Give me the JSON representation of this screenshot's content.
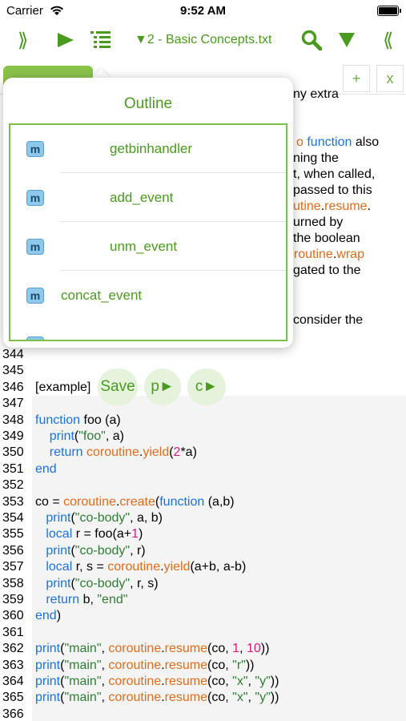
{
  "status_bar": {
    "carrier": "Carrier",
    "time": "9:52 AM"
  },
  "toolbar": {
    "expand": "⟫",
    "collapse": "⟪",
    "file_title": "▼2 - Basic Concepts.txt"
  },
  "tabs": {
    "add": "+",
    "close": "x"
  },
  "prose": [
    {
      "parts": [
        {
          "t": "ny extra",
          "c": ""
        }
      ]
    },
    {
      "parts": [
        {
          "t": "o ",
          "c": "orange"
        },
        {
          "t": "function",
          "c": "blue"
        },
        {
          "t": " also",
          "c": ""
        }
      ]
    },
    {
      "parts": [
        {
          "t": "ning the",
          "c": ""
        }
      ]
    },
    {
      "parts": [
        {
          "t": "t, when called,",
          "c": ""
        }
      ]
    },
    {
      "parts": [
        {
          "t": "passed to this",
          "c": ""
        }
      ]
    },
    {
      "parts": [
        {
          "t": "utine",
          "c": "orange"
        },
        {
          "t": ".",
          "c": ""
        },
        {
          "t": "resume",
          "c": "orange"
        },
        {
          "t": ".",
          "c": ""
        }
      ]
    },
    {
      "parts": [
        {
          "t": "urned by",
          "c": ""
        }
      ]
    },
    {
      "parts": [
        {
          "t": "the boolean",
          "c": ""
        }
      ]
    },
    {
      "parts": [
        {
          "t": "oroutine",
          "c": "orange"
        },
        {
          "t": ".",
          "c": ""
        },
        {
          "t": "wrap",
          "c": "orange"
        }
      ]
    },
    {
      "parts": [
        {
          "t": "gated to the",
          "c": ""
        }
      ]
    },
    {
      "parts": [
        {
          "t": "consider the",
          "c": ""
        }
      ]
    }
  ],
  "example": {
    "label": "[example]",
    "save": "Save",
    "p": "p►",
    "c": "c►"
  },
  "code_lines": [
    {
      "n": "344",
      "parts": []
    },
    {
      "n": "345",
      "parts": []
    },
    {
      "n": "346",
      "parts": []
    },
    {
      "n": "347",
      "parts": []
    },
    {
      "n": "348",
      "parts": [
        {
          "t": "function",
          "c": "kw"
        },
        {
          "t": " foo (a)",
          "c": ""
        }
      ]
    },
    {
      "n": "349",
      "parts": [
        {
          "t": "    ",
          "c": ""
        },
        {
          "t": "print",
          "c": "kw"
        },
        {
          "t": "(",
          "c": ""
        },
        {
          "t": "\"foo\"",
          "c": "str"
        },
        {
          "t": ", a)",
          "c": ""
        }
      ]
    },
    {
      "n": "350",
      "parts": [
        {
          "t": "    ",
          "c": ""
        },
        {
          "t": "return",
          "c": "kw"
        },
        {
          "t": " ",
          "c": ""
        },
        {
          "t": "coroutine",
          "c": "fn"
        },
        {
          "t": ".",
          "c": ""
        },
        {
          "t": "yield",
          "c": "fn"
        },
        {
          "t": "(",
          "c": ""
        },
        {
          "t": "2",
          "c": "num"
        },
        {
          "t": "*a)",
          "c": ""
        }
      ]
    },
    {
      "n": "351",
      "parts": [
        {
          "t": "end",
          "c": "kw"
        }
      ]
    },
    {
      "n": "352",
      "parts": []
    },
    {
      "n": "353",
      "parts": [
        {
          "t": "co = ",
          "c": ""
        },
        {
          "t": "coroutine",
          "c": "fn"
        },
        {
          "t": ".",
          "c": ""
        },
        {
          "t": "create",
          "c": "fn"
        },
        {
          "t": "(",
          "c": ""
        },
        {
          "t": "function",
          "c": "kw"
        },
        {
          "t": " (a,b)",
          "c": ""
        }
      ]
    },
    {
      "n": "354",
      "parts": [
        {
          "t": "   ",
          "c": ""
        },
        {
          "t": "print",
          "c": "kw"
        },
        {
          "t": "(",
          "c": ""
        },
        {
          "t": "\"co-body\"",
          "c": "str"
        },
        {
          "t": ", a, b)",
          "c": ""
        }
      ]
    },
    {
      "n": "355",
      "parts": [
        {
          "t": "   ",
          "c": ""
        },
        {
          "t": "local",
          "c": "kw"
        },
        {
          "t": " r = foo(a+",
          "c": ""
        },
        {
          "t": "1",
          "c": "num"
        },
        {
          "t": ")",
          "c": ""
        }
      ]
    },
    {
      "n": "356",
      "parts": [
        {
          "t": "   ",
          "c": ""
        },
        {
          "t": "print",
          "c": "kw"
        },
        {
          "t": "(",
          "c": ""
        },
        {
          "t": "\"co-body\"",
          "c": "str"
        },
        {
          "t": ", r)",
          "c": ""
        }
      ]
    },
    {
      "n": "357",
      "parts": [
        {
          "t": "   ",
          "c": ""
        },
        {
          "t": "local",
          "c": "kw"
        },
        {
          "t": " r, s = ",
          "c": ""
        },
        {
          "t": "coroutine",
          "c": "fn"
        },
        {
          "t": ".",
          "c": ""
        },
        {
          "t": "yield",
          "c": "fn"
        },
        {
          "t": "(a+b, a-b)",
          "c": ""
        }
      ]
    },
    {
      "n": "358",
      "parts": [
        {
          "t": "   ",
          "c": ""
        },
        {
          "t": "print",
          "c": "kw"
        },
        {
          "t": "(",
          "c": ""
        },
        {
          "t": "\"co-body\"",
          "c": "str"
        },
        {
          "t": ", r, s)",
          "c": ""
        }
      ]
    },
    {
      "n": "359",
      "parts": [
        {
          "t": "   ",
          "c": ""
        },
        {
          "t": "return",
          "c": "kw"
        },
        {
          "t": " b, ",
          "c": ""
        },
        {
          "t": "\"end\"",
          "c": "str"
        }
      ]
    },
    {
      "n": "360",
      "parts": [
        {
          "t": "end",
          "c": "kw"
        },
        {
          "t": ")",
          "c": ""
        }
      ]
    },
    {
      "n": "361",
      "parts": []
    },
    {
      "n": "362",
      "parts": [
        {
          "t": "print",
          "c": "kw"
        },
        {
          "t": "(",
          "c": ""
        },
        {
          "t": "\"main\"",
          "c": "str"
        },
        {
          "t": ", ",
          "c": ""
        },
        {
          "t": "coroutine",
          "c": "fn"
        },
        {
          "t": ".",
          "c": ""
        },
        {
          "t": "resume",
          "c": "fn"
        },
        {
          "t": "(co, ",
          "c": ""
        },
        {
          "t": "1",
          "c": "num"
        },
        {
          "t": ", ",
          "c": ""
        },
        {
          "t": "10",
          "c": "num"
        },
        {
          "t": "))",
          "c": ""
        }
      ]
    },
    {
      "n": "363",
      "parts": [
        {
          "t": "print",
          "c": "kw"
        },
        {
          "t": "(",
          "c": ""
        },
        {
          "t": "\"main\"",
          "c": "str"
        },
        {
          "t": ", ",
          "c": ""
        },
        {
          "t": "coroutine",
          "c": "fn"
        },
        {
          "t": ".",
          "c": ""
        },
        {
          "t": "resume",
          "c": "fn"
        },
        {
          "t": "(co, ",
          "c": ""
        },
        {
          "t": "\"r\"",
          "c": "str"
        },
        {
          "t": "))",
          "c": ""
        }
      ]
    },
    {
      "n": "364",
      "parts": [
        {
          "t": "print",
          "c": "kw"
        },
        {
          "t": "(",
          "c": ""
        },
        {
          "t": "\"main\"",
          "c": "str"
        },
        {
          "t": ", ",
          "c": ""
        },
        {
          "t": "coroutine",
          "c": "fn"
        },
        {
          "t": ".",
          "c": ""
        },
        {
          "t": "resume",
          "c": "fn"
        },
        {
          "t": "(co, ",
          "c": ""
        },
        {
          "t": "\"x\"",
          "c": "str"
        },
        {
          "t": ", ",
          "c": ""
        },
        {
          "t": "\"y\"",
          "c": "str"
        },
        {
          "t": "))",
          "c": ""
        }
      ]
    },
    {
      "n": "365",
      "parts": [
        {
          "t": "print",
          "c": "kw"
        },
        {
          "t": "(",
          "c": ""
        },
        {
          "t": "\"main\"",
          "c": "str"
        },
        {
          "t": ", ",
          "c": ""
        },
        {
          "t": "coroutine",
          "c": "fn"
        },
        {
          "t": ".",
          "c": ""
        },
        {
          "t": "resume",
          "c": "fn"
        },
        {
          "t": "(co, ",
          "c": ""
        },
        {
          "t": "\"x\"",
          "c": "str"
        },
        {
          "t": ", ",
          "c": ""
        },
        {
          "t": "\"y\"",
          "c": "str"
        },
        {
          "t": "))",
          "c": ""
        }
      ]
    },
    {
      "n": "366",
      "parts": []
    }
  ],
  "outline": {
    "title": "Outline",
    "badge": "m",
    "items": [
      {
        "label": "getbinhandler",
        "indented": true
      },
      {
        "label": "add_event",
        "indented": true
      },
      {
        "label": "unm_event",
        "indented": true
      },
      {
        "label": "concat_event",
        "indented": false
      },
      {
        "label": "",
        "indented": false
      }
    ]
  },
  "colors": {
    "accent": "#4a9a1f",
    "keyword": "#1a73d9",
    "library": "#e06c1a",
    "string": "#2e7d32",
    "number": "#d81b7a"
  }
}
